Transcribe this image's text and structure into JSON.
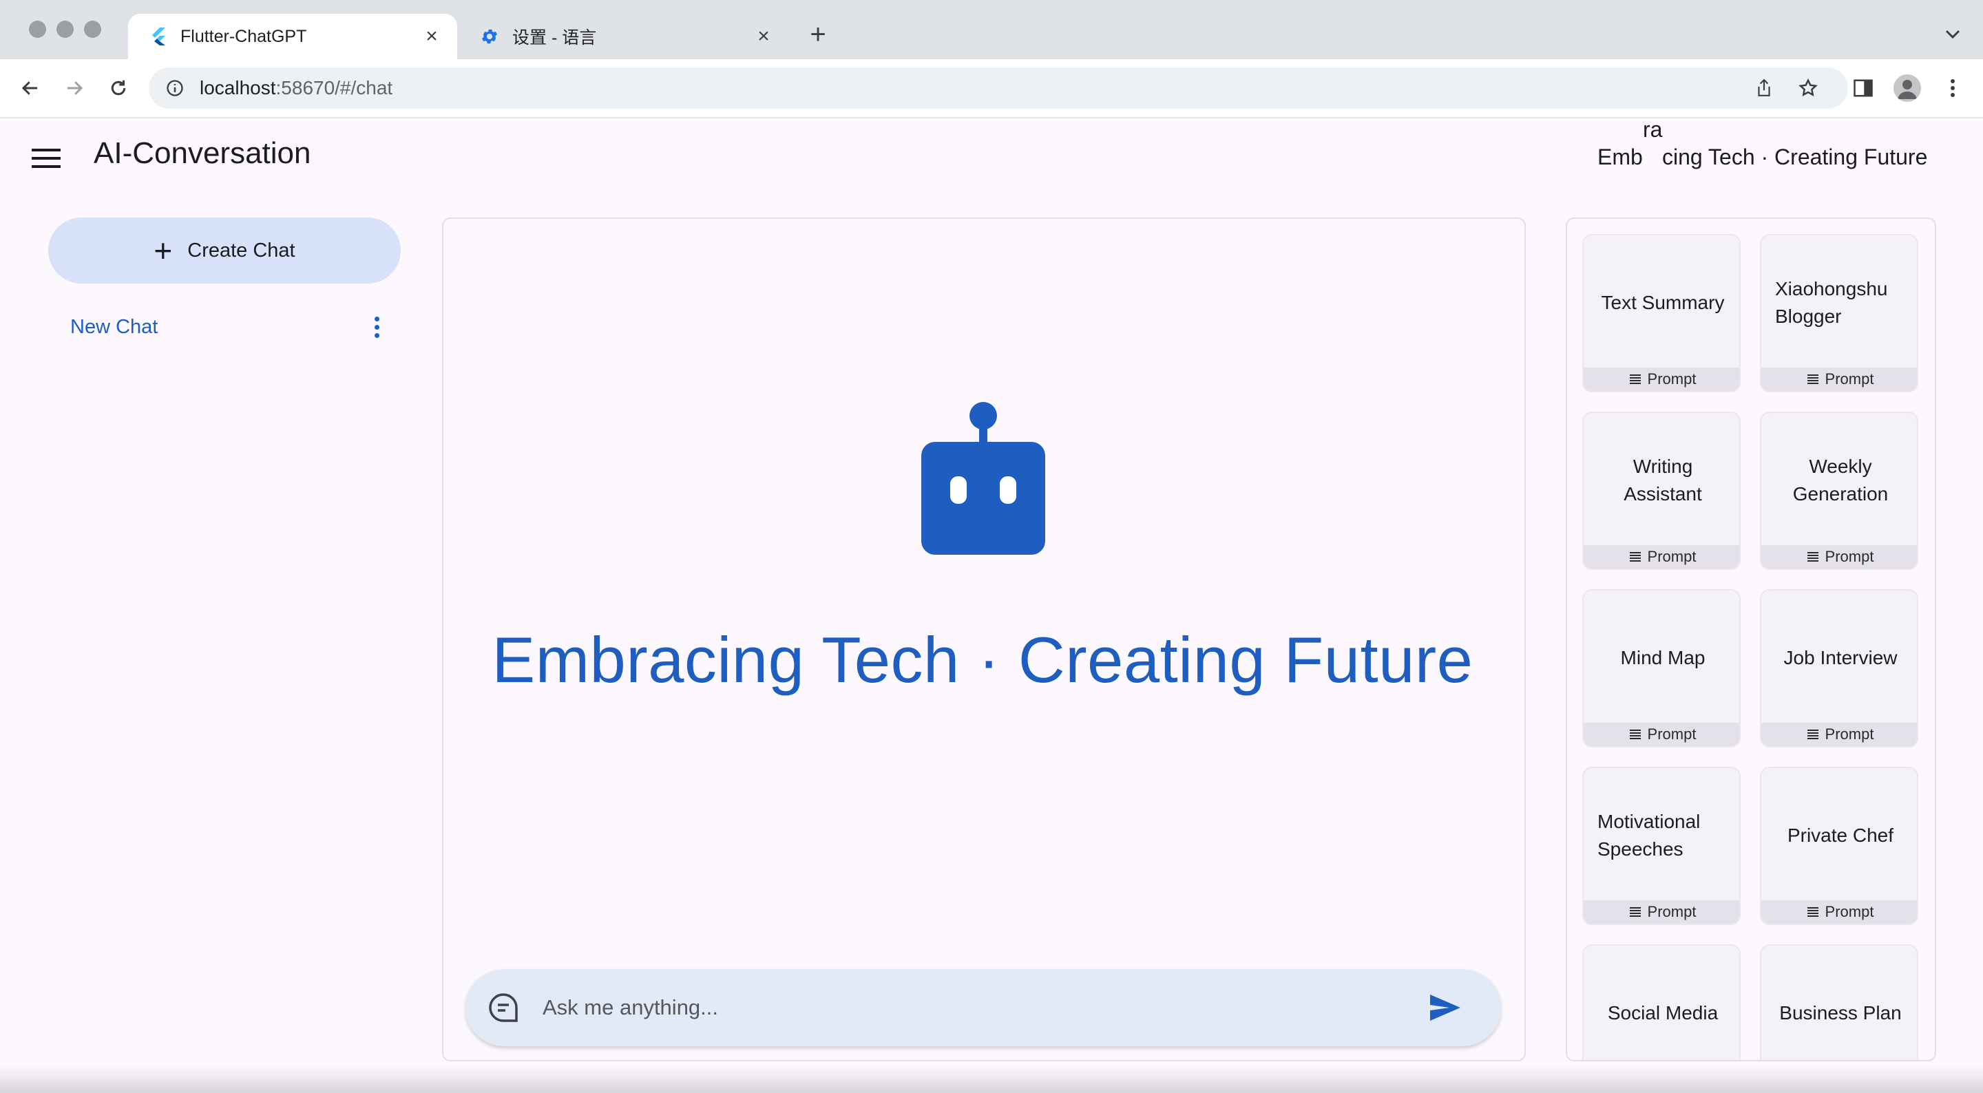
{
  "browser": {
    "tabs": [
      {
        "title": "Flutter-ChatGPT",
        "icon": "flutter-icon",
        "active": true
      },
      {
        "title": "设置 - 语言",
        "icon": "settings-gear-icon",
        "active": false
      }
    ],
    "url_host": "localhost",
    "url_rest": ":58670/#/chat"
  },
  "app": {
    "title": "AI-Conversation",
    "header_slogan_fragments": [
      "ra",
      "Emb",
      "cing Tech · Creating Future"
    ]
  },
  "sidebar": {
    "create_button_label": "Create Chat",
    "chats": [
      {
        "label": "New Chat"
      }
    ]
  },
  "main": {
    "hero_text": "Embracing Tech · Creating Future",
    "input_placeholder": "Ask me anything...",
    "accent_color": "#1d5ec0"
  },
  "prompts": {
    "tag_label": "Prompt",
    "cards": [
      {
        "title": "Text Summary"
      },
      {
        "title": "Xiaohongshu Blogger"
      },
      {
        "title": "Writing Assistant"
      },
      {
        "title": "Weekly Generation"
      },
      {
        "title": "Mind Map"
      },
      {
        "title": "Job Interview"
      },
      {
        "title": "Motivational Speeches"
      },
      {
        "title": "Private Chef"
      },
      {
        "title": "Social Media"
      },
      {
        "title": "Business Plan"
      }
    ]
  }
}
